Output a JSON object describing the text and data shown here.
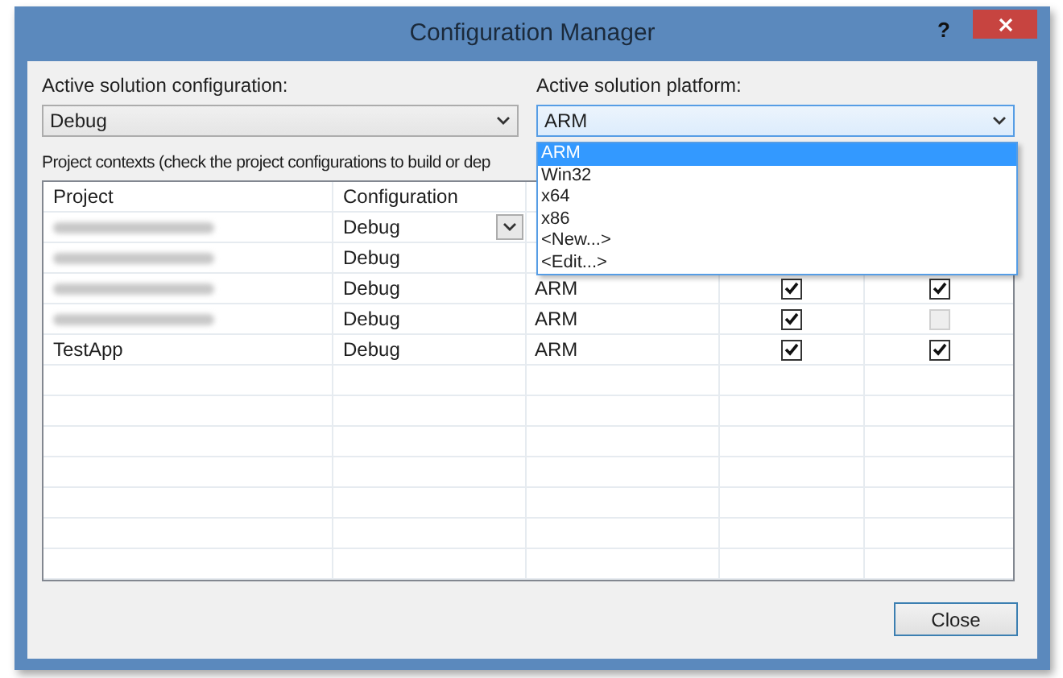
{
  "window": {
    "title": "Configuration Manager",
    "help": "?"
  },
  "solution_configuration": {
    "label": "Active solution configuration:",
    "value": "Debug"
  },
  "solution_platform": {
    "label": "Active solution platform:",
    "value": "ARM",
    "expanded": true,
    "options": [
      {
        "label": "ARM",
        "selected": true
      },
      {
        "label": "Win32",
        "selected": false
      },
      {
        "label": "x64",
        "selected": false
      },
      {
        "label": "x86",
        "selected": false
      },
      {
        "label": "<New...>",
        "selected": false
      },
      {
        "label": "<Edit...>",
        "selected": false
      }
    ]
  },
  "contexts_label": "Project contexts (check the project configurations to build or dep",
  "table": {
    "columns": [
      "Project",
      "Configuration"
    ],
    "rows": [
      {
        "kind": "blurred",
        "configuration": "Debug",
        "editing": true
      },
      {
        "kind": "blurred",
        "configuration": "Debug",
        "editing": false
      },
      {
        "kind": "blurred",
        "configuration": "Debug",
        "editing": false,
        "platform": "ARM",
        "build": {
          "checked": true,
          "disabled": false
        },
        "deploy": {
          "checked": true,
          "disabled": false
        }
      },
      {
        "kind": "blurred",
        "configuration": "Debug",
        "editing": false,
        "platform": "ARM",
        "build": {
          "checked": true,
          "disabled": false
        },
        "deploy": {
          "checked": false,
          "disabled": true
        }
      },
      {
        "kind": "text",
        "project": "TestApp",
        "configuration": "Debug",
        "editing": false,
        "platform": "ARM",
        "build": {
          "checked": true,
          "disabled": false
        },
        "deploy": {
          "checked": true,
          "disabled": false
        }
      }
    ]
  },
  "buttons": [
    {
      "label": "Close"
    }
  ]
}
